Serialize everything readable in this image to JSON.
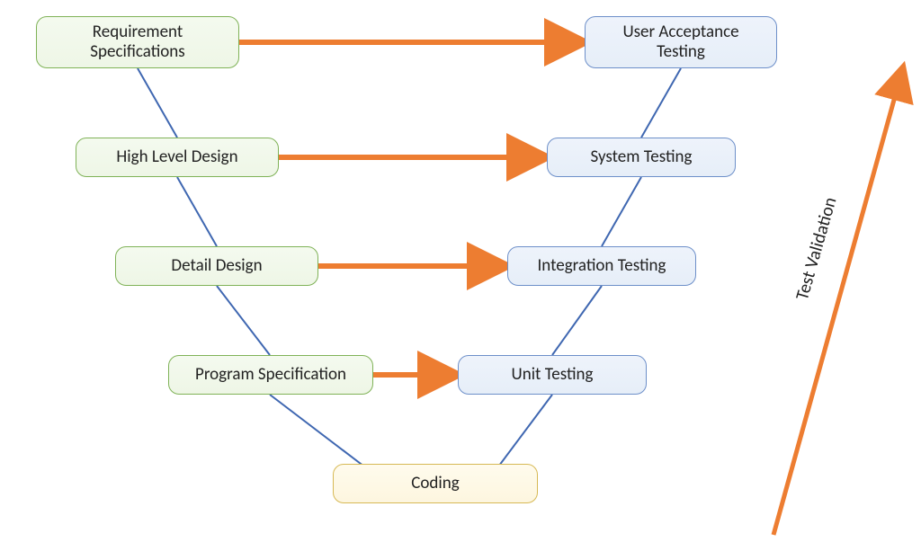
{
  "diagram": {
    "type": "v-model",
    "left_nodes": [
      {
        "id": "req",
        "label": "Requirement\nSpecifications"
      },
      {
        "id": "hld",
        "label": "High Level Design"
      },
      {
        "id": "dd",
        "label": "Detail Design"
      },
      {
        "id": "ps",
        "label": "Program Specification"
      }
    ],
    "right_nodes": [
      {
        "id": "uat",
        "label": "User Acceptance\nTesting"
      },
      {
        "id": "st",
        "label": "System Testing"
      },
      {
        "id": "it",
        "label": "Integration Testing"
      },
      {
        "id": "ut",
        "label": "Unit Testing"
      }
    ],
    "bottom_node": {
      "id": "code",
      "label": "Coding"
    },
    "side_label": "Test Validation",
    "colors": {
      "left_fill": "#f1f8ea",
      "left_border": "#7fb257",
      "right_fill": "#eaf0fa",
      "right_border": "#6d8fc9",
      "bottom_fill": "#fef8e4",
      "bottom_border": "#d7b955",
      "v_line": "#3f67b1",
      "arrow": "#ed7d31"
    },
    "horizontal_links": [
      {
        "from": "req",
        "to": "uat"
      },
      {
        "from": "hld",
        "to": "st"
      },
      {
        "from": "dd",
        "to": "it"
      },
      {
        "from": "ps",
        "to": "ut"
      }
    ]
  }
}
